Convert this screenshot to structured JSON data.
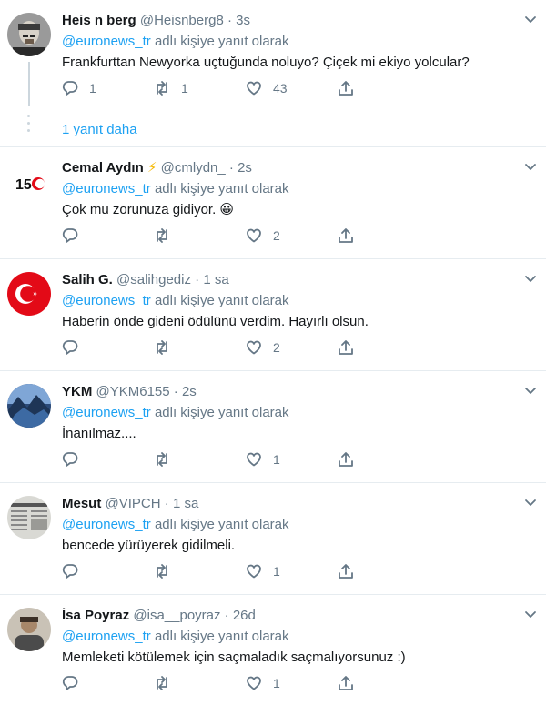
{
  "colors": {
    "accent": "#1da1f2",
    "muted": "#657786",
    "text": "#14171a",
    "divider": "#e6ecf0"
  },
  "reply_prefix": "@euronews_tr",
  "reply_suffix": "adlı kişiye yanıt olarak",
  "more_replies": "1 yanıt daha",
  "tweets": [
    {
      "name": "Heis n berg",
      "handle": "@Heisnberg8",
      "dot": "·",
      "time": "3s",
      "text": "Frankfurttan Newyorka uçtuğunda noluyo? Çiçek mi ekiyo yolcular?",
      "replies": "1",
      "retweets": "1",
      "likes": "43",
      "avatar": "man-portrait-avatar"
    },
    {
      "name": "Cemal Aydın",
      "badge": "⚡",
      "handle": "@cmlydn_",
      "dot": "·",
      "time": "2s",
      "text": "Çok mu zorunuza gidiyor. 😀",
      "replies": "",
      "retweets": "",
      "likes": "2",
      "avatar": "150-logo-avatar"
    },
    {
      "name": "Salih G.",
      "handle": "@salihgediz",
      "dot": "·",
      "time": "1 sa",
      "text": "Haberin önde gideni ödülünü verdim. Hayırlı olsun.",
      "replies": "",
      "retweets": "",
      "likes": "2",
      "avatar": "turkish-flag-avatar"
    },
    {
      "name": "YKM",
      "handle": "@YKM6155",
      "dot": "·",
      "time": "2s",
      "text": "İnanılmaz....",
      "replies": "",
      "retweets": "",
      "likes": "1",
      "avatar": "landscape-avatar"
    },
    {
      "name": "Mesut",
      "handle": "@VIPCH",
      "dot": "·",
      "time": "1 sa",
      "text": "bencede yürüyerek gidilmeli.",
      "replies": "",
      "retweets": "",
      "likes": "1",
      "avatar": "newspaper-avatar"
    },
    {
      "name": "İsa Poyraz",
      "handle": "@isa__poyraz",
      "dot": "·",
      "time": "26d",
      "text": "Memleketi kötülemek için saçmaladık saçmalıyorsunuz :)",
      "replies": "",
      "retweets": "",
      "likes": "1",
      "avatar": "person-photo-avatar"
    }
  ]
}
